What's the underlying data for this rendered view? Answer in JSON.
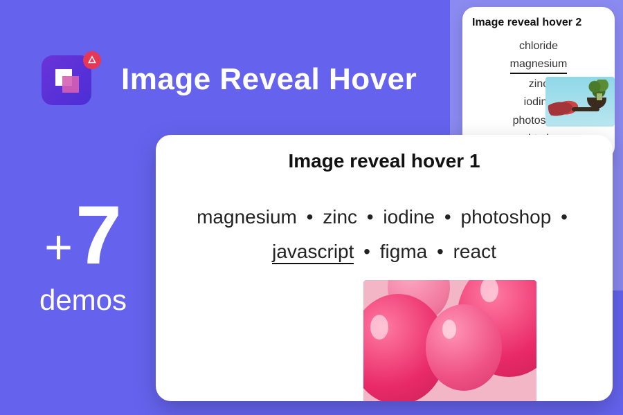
{
  "hero": {
    "title": "Image Reveal Hover"
  },
  "demos": {
    "prefix": "+",
    "count": "7",
    "label": "demos"
  },
  "card1": {
    "title": "Image reveal hover 1",
    "tags": [
      "magnesium",
      "zinc",
      "iodine",
      "photoshop",
      "javascript",
      "figma",
      "react"
    ],
    "active": "javascript"
  },
  "card2": {
    "title": "Image reveal hover 2",
    "items": [
      "chloride",
      "magnesium",
      "zinc",
      "iodine",
      "photoshop",
      "html"
    ],
    "active": "magnesium"
  }
}
